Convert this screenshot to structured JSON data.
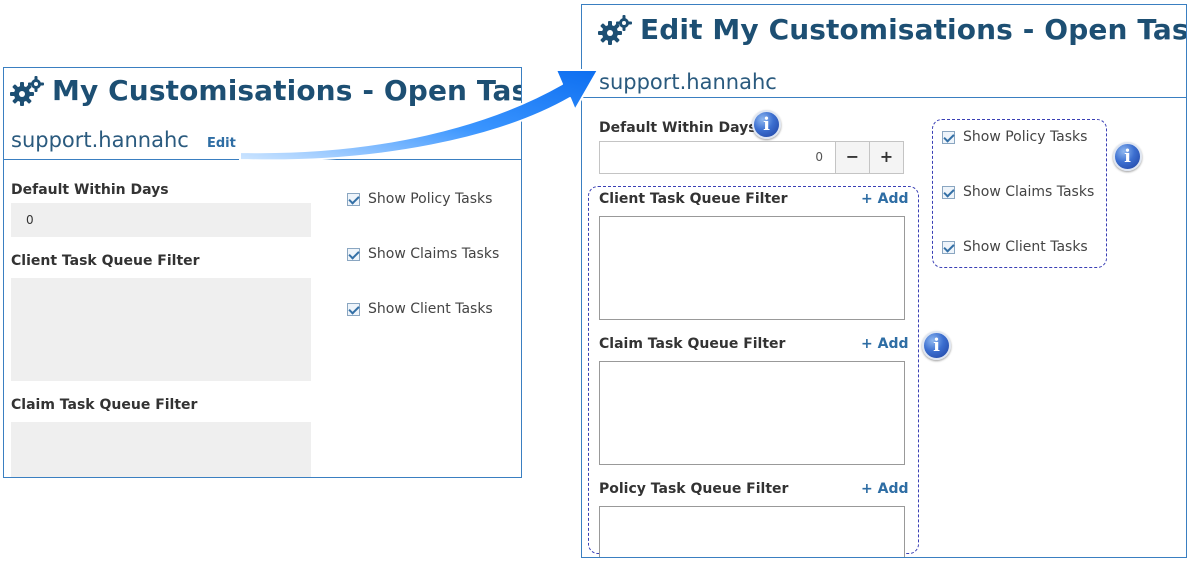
{
  "left_panel": {
    "title": "My Customisations - Open Tasks",
    "username": "support.hannahc",
    "edit_label": "Edit",
    "default_within_days_label": "Default Within Days",
    "default_within_days_value": "0",
    "client_filter_label": "Client Task Queue Filter",
    "claim_filter_label": "Claim Task Queue Filter",
    "checkboxes": [
      {
        "label": "Show Policy Tasks",
        "checked": true
      },
      {
        "label": "Show Claims Tasks",
        "checked": true
      },
      {
        "label": "Show Client Tasks",
        "checked": true
      }
    ]
  },
  "right_panel": {
    "title": "Edit My Customisations - Open Tasks",
    "username": "support.hannahc",
    "default_within_days_label": "Default Within Days",
    "default_within_days_value": "0",
    "minus_label": "−",
    "plus_label": "+",
    "client_filter_label": "Client Task Queue Filter",
    "claim_filter_label": "Claim Task Queue Filter",
    "policy_filter_label": "Policy Task Queue Filter",
    "add_label": "+ Add",
    "checkboxes": [
      {
        "label": "Show Policy Tasks",
        "checked": true
      },
      {
        "label": "Show Claims Tasks",
        "checked": true
      },
      {
        "label": "Show Client Tasks",
        "checked": true
      }
    ],
    "info_glyph": "i"
  },
  "colors": {
    "accent": "#3a7fc1",
    "title": "#1d4f73",
    "link": "#2e6da4",
    "arrow": "#1e7ef5",
    "dashed": "#3a3fb5"
  },
  "icons": [
    "gears-icon",
    "checkbox-icon",
    "info-icon",
    "callout-arrow"
  ]
}
